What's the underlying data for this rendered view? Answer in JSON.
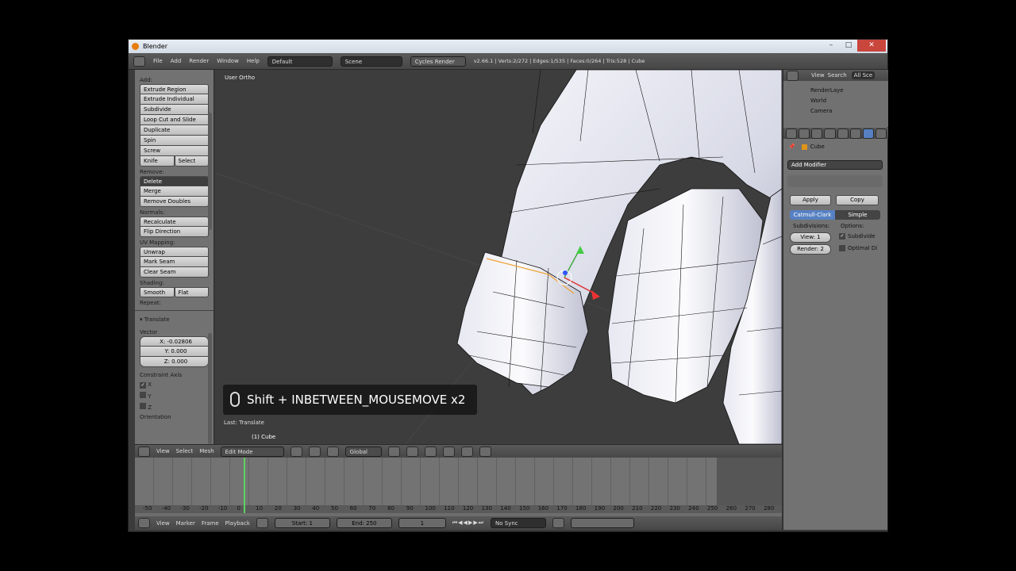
{
  "window": {
    "title": "Blender"
  },
  "menubar": {
    "items": [
      "File",
      "Add",
      "Render",
      "Window",
      "Help"
    ],
    "layout": "Default",
    "scene": "Scene",
    "engine": "Cycles Render",
    "stats": "v2.66.1 | Verts:2/272 | Edges:1/535 | Faces:0/264 | Tris:528 | Cube"
  },
  "toolshelf": {
    "top_label": "Add:",
    "add": [
      "Extrude Region",
      "Extrude Individual",
      "Subdivide",
      "Loop Cut and Slide",
      "Duplicate",
      "Spin",
      "Screw"
    ],
    "knife": "Knife",
    "select": "Select",
    "remove_label": "Remove:",
    "delete": "Delete",
    "merge": "Merge",
    "remove_doubles": "Remove Doubles",
    "normals_label": "Normals:",
    "recalculate": "Recalculate",
    "flip_direction": "Flip Direction",
    "uv_label": "UV Mapping:",
    "unwrap": "Unwrap",
    "mark_seam": "Mark Seam",
    "clear_seam": "Clear Seam",
    "shading_label": "Shading:",
    "smooth": "Smooth",
    "flat": "Flat",
    "repeat_label": "Repeat:",
    "translate_header": "Translate",
    "vector_label": "Vector",
    "x": "X: -0.02806",
    "y": "Y: 0.000",
    "z": "Z: 0.000",
    "constraint_label": "Constraint Axis",
    "cx": "X",
    "cy": "Y",
    "cz": "Z",
    "orientation_label": "Orientation"
  },
  "viewport": {
    "view_label": "User Ortho",
    "osd": "Shift + INBETWEEN_MOUSEMOVE x2",
    "last_op": "Last: Translate",
    "object": "(1) Cube"
  },
  "view_header": {
    "items": [
      "View",
      "Select",
      "Mesh"
    ],
    "mode": "Edit Mode",
    "orientation": "Global"
  },
  "timeline": {
    "ticks": [
      "-50",
      "-40",
      "-30",
      "-20",
      "-10",
      "0",
      "10",
      "20",
      "30",
      "40",
      "50",
      "60",
      "70",
      "80",
      "90",
      "100",
      "110",
      "120",
      "130",
      "140",
      "150",
      "160",
      "170",
      "180",
      "190",
      "200",
      "210",
      "220",
      "230",
      "240",
      "250",
      "260",
      "270",
      "280"
    ],
    "menu": [
      "View",
      "Marker",
      "Frame",
      "Playback"
    ],
    "start": "Start: 1",
    "end": "End: 250",
    "current": "1",
    "sync": "No Sync"
  },
  "outliner": {
    "view": "View",
    "search": "Search",
    "all": "All Sce",
    "items": [
      "RenderLaye",
      "World",
      "Camera"
    ]
  },
  "properties": {
    "object": "Cube",
    "add_modifier": "Add Modifier",
    "apply": "Apply",
    "copy": "Copy",
    "catmull": "Catmull-Clark",
    "simple": "Simple",
    "subdivisions_label": "Subdivisions:",
    "options_label": "Options:",
    "view": "View: 1",
    "render": "Render: 2",
    "subdivide_uvs": "Subdivide",
    "optimal": "Optimal Di"
  },
  "colors": {
    "accent": "#5680c2",
    "playhead": "#5fd35f"
  }
}
